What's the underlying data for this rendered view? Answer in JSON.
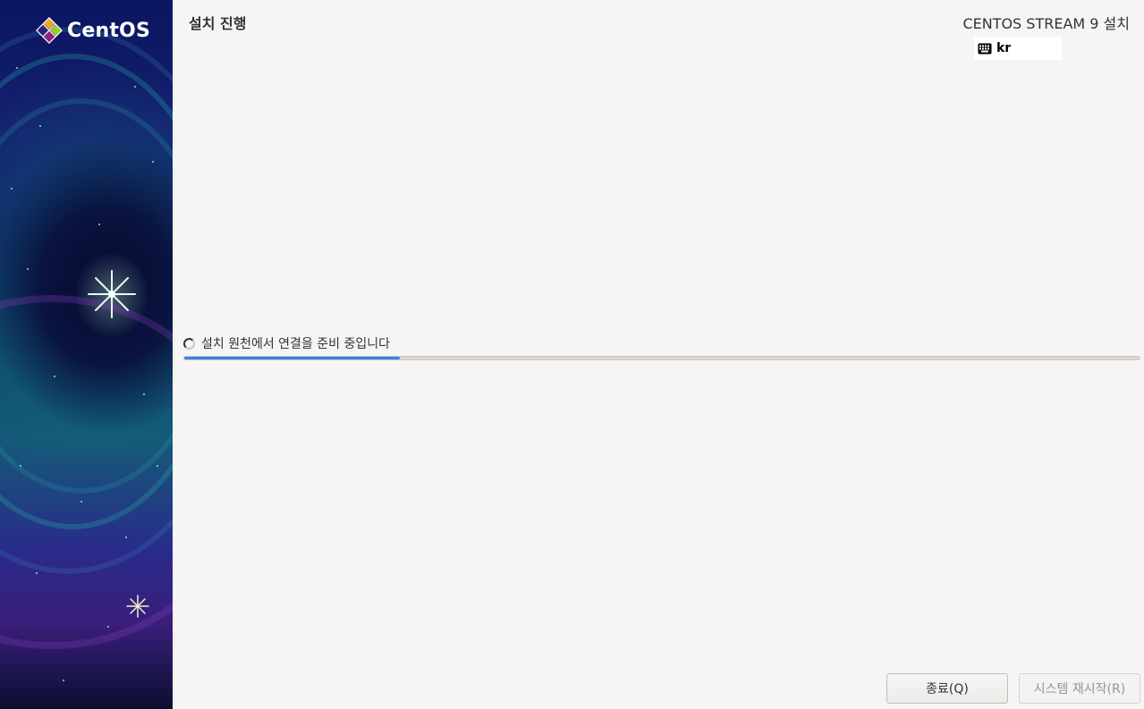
{
  "sidebar": {
    "logo_text": "CentOS"
  },
  "header": {
    "page_title": "설치 진행",
    "product_title": "CENTOS STREAM 9 설치",
    "keyboard_layout": "kr",
    "keyboard_icon": "keyboard-icon"
  },
  "progress": {
    "status_text": "설치 원천에서 연결을 준비 중입니다",
    "fraction": 0.226,
    "spinner_icon": "spinner-icon",
    "accent_color": "#3584e4"
  },
  "buttons": {
    "quit_label": "종료(Q)",
    "reboot_label": "시스템 재시작(R)"
  }
}
